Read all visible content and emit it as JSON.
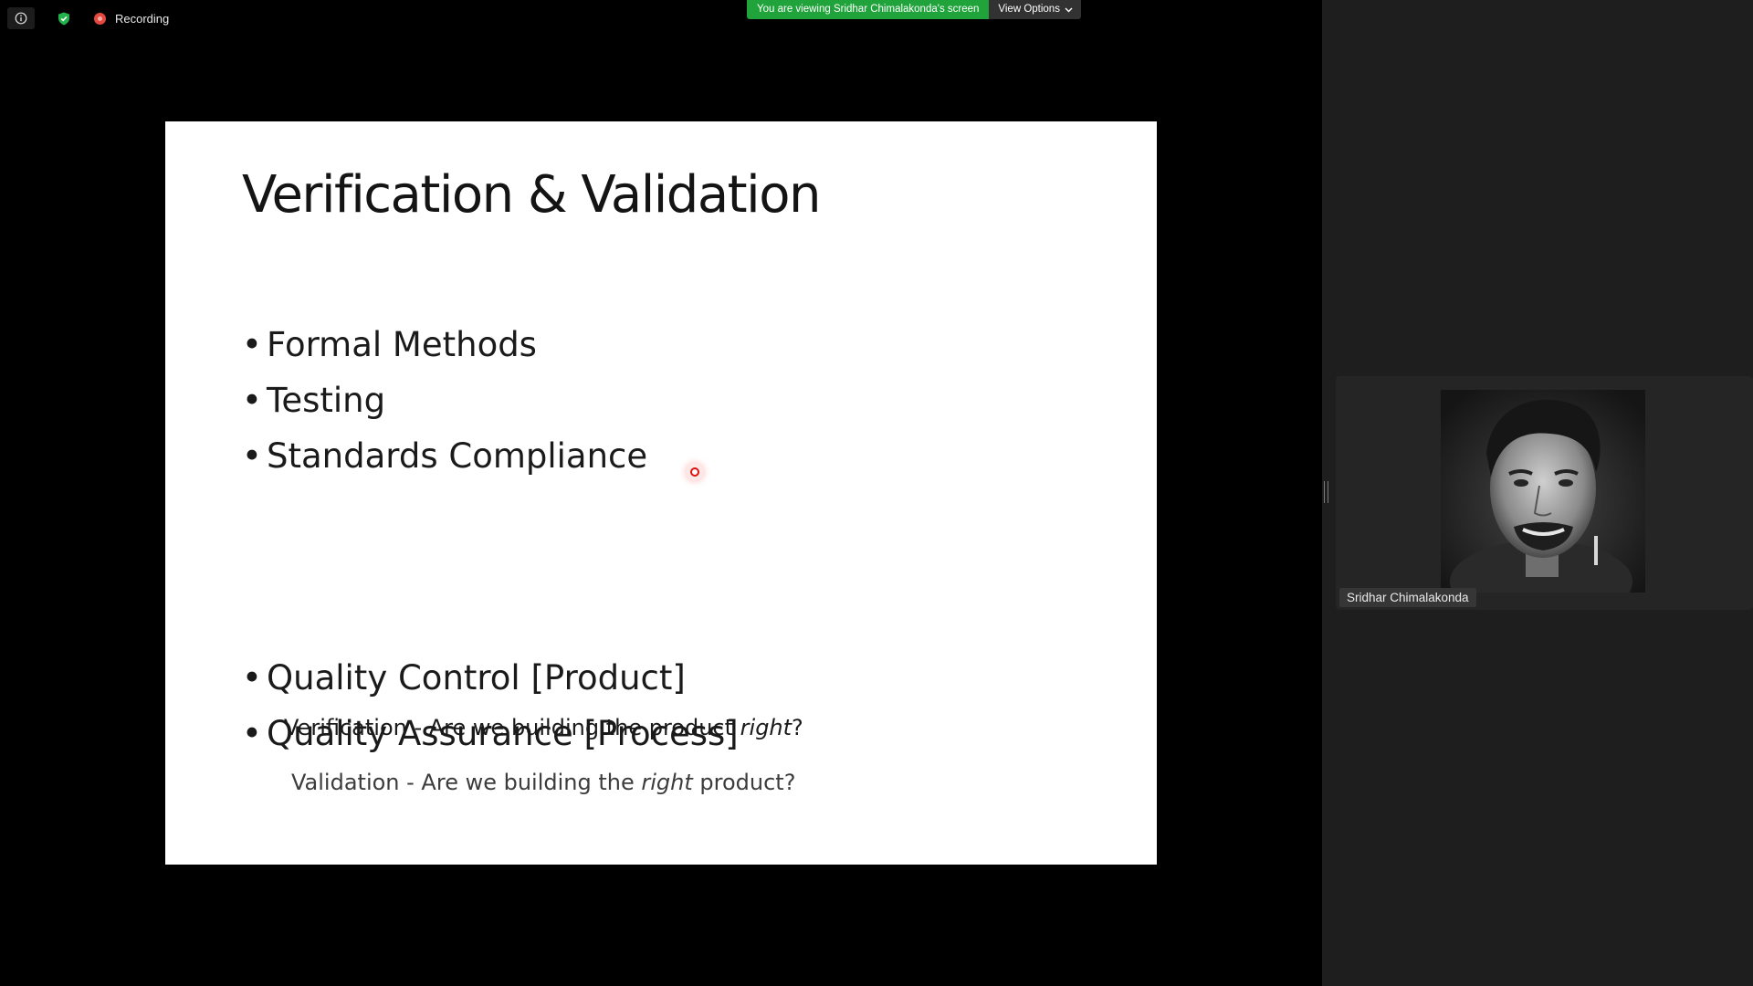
{
  "meeting": {
    "recording_label": "Recording",
    "banner_text": "You are viewing Sridhar Chimalakonda's screen",
    "view_options_label": "View Options"
  },
  "slide": {
    "title": "Verification & Validation",
    "bullets_group_1": [
      "Formal Methods",
      "Testing",
      "Standards Compliance"
    ],
    "bullets_group_2": [
      "Quality Control [Product]",
      "Quality Assurance [Process]"
    ],
    "verification_note": {
      "prefix": "Verification - Are we building the product ",
      "emphasis": "right",
      "suffix": "?"
    },
    "validation_note": {
      "prefix": "Validation - Are we building the ",
      "emphasis": "right",
      "suffix": " product?"
    }
  },
  "participant": {
    "name": "Sridhar Chimalakonda"
  },
  "colors": {
    "banner_green": "#1fa33a",
    "recording_red": "#e5483e",
    "security_green": "#23b24b",
    "panel_bg": "#1e1e1e"
  },
  "icons": [
    "info-icon",
    "shield-check-icon",
    "recording-icon",
    "chevron-down-icon",
    "laser-pointer-icon"
  ]
}
